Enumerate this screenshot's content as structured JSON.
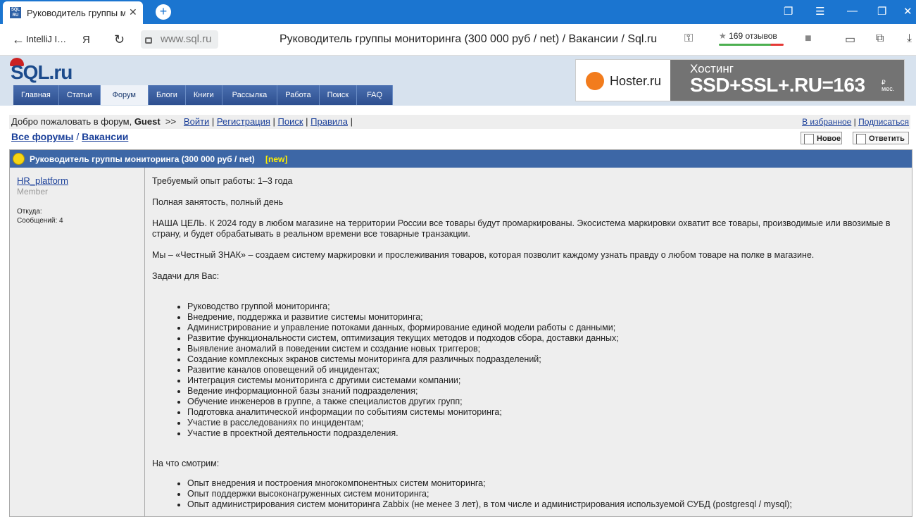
{
  "browser": {
    "tab_title": "Руководитель группы мо",
    "favicon_text": "SQL RU",
    "back_label": "IntelliJ I…",
    "url": "www.sql.ru",
    "page_title": "Руководитель группы мониторинга (300 000 руб / net) / Вакансии / Sql.ru",
    "reviews": "169 отзывов"
  },
  "site": {
    "logo": "SQL.ru",
    "menu": [
      "Главная",
      "Статьи",
      "Форум",
      "Блоги",
      "Книги",
      "Рассылка",
      "Работа",
      "Поиск",
      "FAQ"
    ],
    "active_menu": "Форум",
    "banner": {
      "brand": "Hoster.ru",
      "headline": "Хостинг",
      "big": "SSD+SSL+.RU=163",
      "unit_top": "₽",
      "unit_bottom": "мес."
    }
  },
  "welcome": {
    "prefix": "Добро пожаловать в форум,",
    "user": "Guest",
    "sep": ">>",
    "login": "Войти",
    "register": "Регистрация",
    "search": "Поиск",
    "rules": "Правила",
    "favorites": "В избранное",
    "subscribe": "Подписаться"
  },
  "crumbs": {
    "all_forums": "Все форумы",
    "vacancies": "Вакансии"
  },
  "buttons": {
    "new": "Новое",
    "reply": "Ответить"
  },
  "topic": {
    "title": "Руководитель группы мониторинга (300 000 руб / net)",
    "new_tag": "[new]",
    "author": "HR_platform",
    "role": "Member",
    "from_label": "Откуда:",
    "posts_label": "Сообщений: 4",
    "para1": "Требуемый опыт работы: 1–3 года",
    "para2": "Полная занятость, полный день",
    "para3": "НАША ЦЕЛЬ. К 2024 году в любом магазине на территории России все товары будут промаркированы. Экосистема маркировки охватит все товары, производимые или ввозимые в страну, и будет обрабатывать в реальном времени все товарные транзакции.",
    "para4": "Мы – «Честный ЗНАК» – создаем систему маркировки и прослеживания товаров, которая позволит каждому узнать правду о любом товаре на полке в магазине.",
    "tasks_heading": "Задачи для Вас:",
    "tasks": [
      "Руководство группой мониторинга;",
      "Внедрение, поддержка и развитие системы мониторинга;",
      "Администрирование и управление потоками данных, формирование единой модели работы с данными;",
      "Развитие функциональности систем, оптимизация текущих методов и подходов сбора, доставки данных;",
      "Выявление аномалий в поведении систем и создание новых триггеров;",
      "Создание комплексных экранов системы мониторинга для различных подразделений;",
      "Развитие каналов оповещений об инцидентах;",
      "Интеграция системы мониторинга с другими системами компании;",
      "Ведение информационной базы знаний подразделения;",
      "Обучение инженеров в группе, а также специалистов других групп;",
      "Подготовка аналитической информации по событиям системы мониторинга;",
      "Участие в расследованиях по инцидентам;",
      "Участие в проектной деятельности подразделения."
    ],
    "req_heading": "На что смотрим:",
    "requirements": [
      "Опыт внедрения и построения многокомпонентных систем мониторинга;",
      "Опыт поддержки высоконагруженных систем мониторинга;",
      "Опыт администрирования систем мониторинга Zabbix (не менее 3 лет), в том числе и администрирования используемой СУБД (postgresql / mysql);"
    ]
  }
}
